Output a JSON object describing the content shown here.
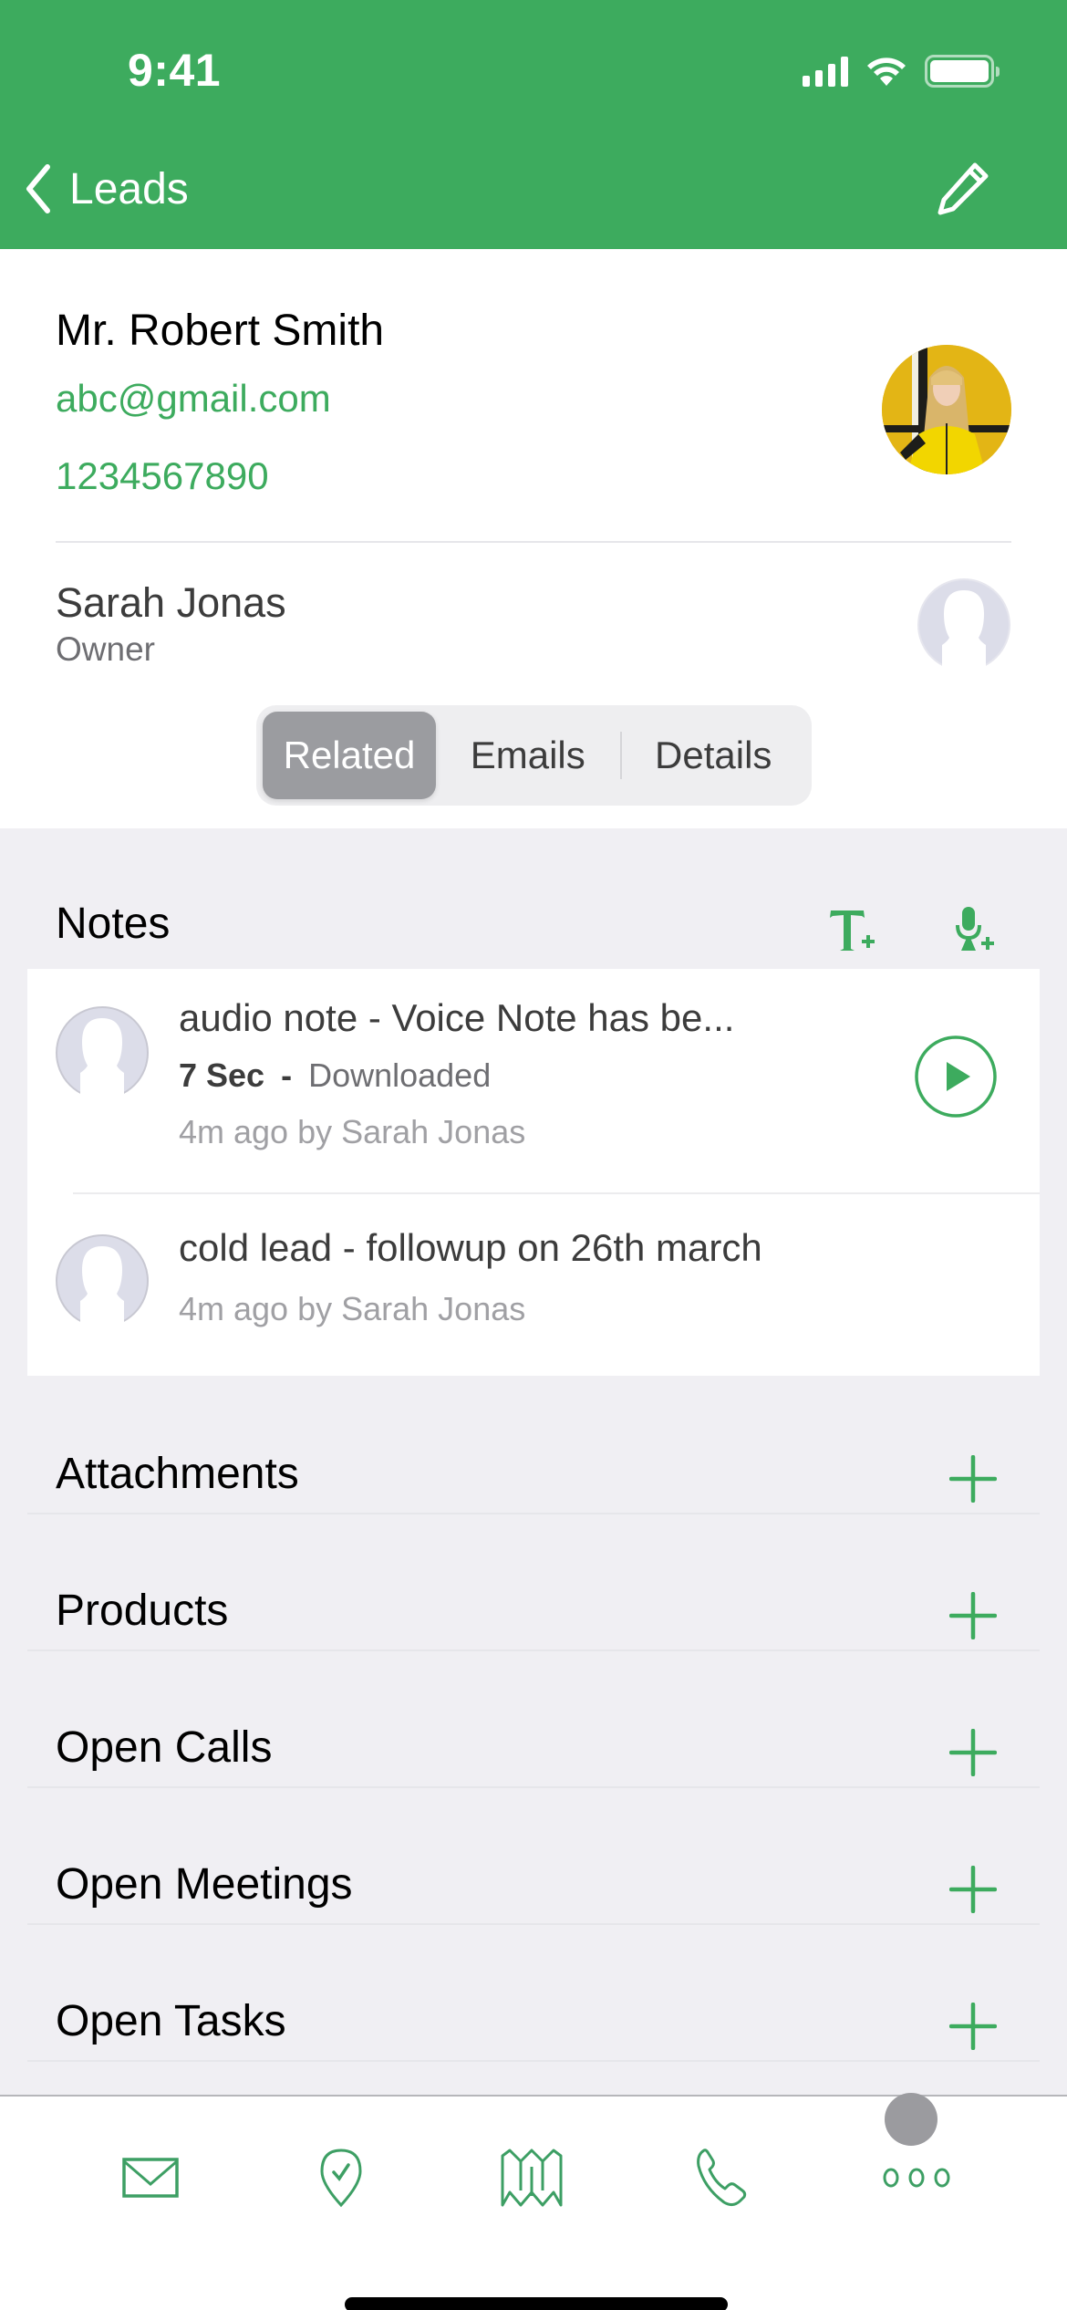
{
  "status_bar": {
    "time": "9:41",
    "icons": [
      "signal-icon",
      "wifi-icon",
      "battery-icon"
    ]
  },
  "nav": {
    "back_label": "Leads",
    "back_icon": "chevron-left-icon",
    "edit_icon": "pencil-icon"
  },
  "contact": {
    "name": "Mr. Robert Smith",
    "email": "abc@gmail.com",
    "phone": "1234567890",
    "photo": "contact-photo"
  },
  "owner": {
    "name": "Sarah Jonas",
    "role": "Owner",
    "avatar": "default-avatar-icon"
  },
  "segments": {
    "items": [
      {
        "label": "Related",
        "active": true
      },
      {
        "label": "Emails",
        "active": false
      },
      {
        "label": "Details",
        "active": false
      }
    ]
  },
  "notes": {
    "title": "Notes",
    "actions": [
      "add-text-note-icon",
      "add-voice-note-icon"
    ],
    "items": [
      {
        "title": "audio note - Voice Note has be...",
        "duration": "7 Sec",
        "separator": "-",
        "status": "Downloaded",
        "meta": "4m ago by Sarah Jonas",
        "has_play": true
      },
      {
        "title": "cold lead - followup on 26th march",
        "meta": "4m ago by Sarah Jonas",
        "has_play": false
      }
    ]
  },
  "sections": [
    {
      "label": "Attachments"
    },
    {
      "label": "Products"
    },
    {
      "label": "Open Calls"
    },
    {
      "label": "Open Meetings"
    },
    {
      "label": "Open Tasks"
    }
  ],
  "tabbar": {
    "items": [
      "email-icon",
      "check-in-location-icon",
      "map-icon",
      "phone-icon",
      "more-icon"
    ]
  },
  "colors": {
    "brand": "#3dab5e",
    "segment_active": "#9b9ca0",
    "background": "#f0eff3"
  }
}
